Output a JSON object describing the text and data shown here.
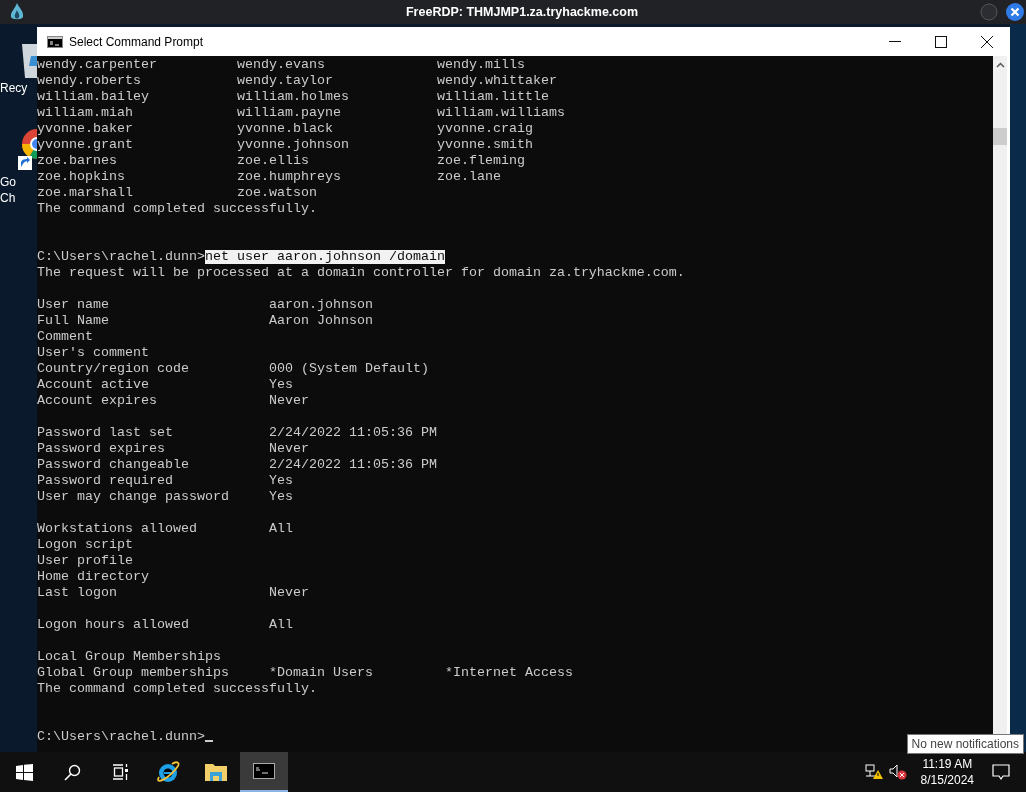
{
  "rdp_window": {
    "title": "FreeRDP: THMJMP1.za.tryhackme.com"
  },
  "desktop_icons": [
    {
      "label_lines": [
        "Recy"
      ],
      "kind": "recycle"
    },
    {
      "label_lines": [
        "Go",
        "Ch"
      ],
      "kind": "browser"
    }
  ],
  "console_window": {
    "title": "Select Command Prompt",
    "lines": [
      {
        "kind": "text",
        "text": "wendy.carpenter          wendy.evans              wendy.mills"
      },
      {
        "kind": "text",
        "text": "wendy.roberts            wendy.taylor             wendy.whittaker"
      },
      {
        "kind": "text",
        "text": "william.bailey           william.holmes           william.little"
      },
      {
        "kind": "text",
        "text": "william.miah             william.payne            william.williams"
      },
      {
        "kind": "text",
        "text": "yvonne.baker             yvonne.black             yvonne.craig"
      },
      {
        "kind": "text",
        "text": "yvonne.grant             yvonne.johnson           yvonne.smith"
      },
      {
        "kind": "text",
        "text": "zoe.barnes               zoe.ellis                zoe.fleming"
      },
      {
        "kind": "text",
        "text": "zoe.hopkins              zoe.humphreys            zoe.lane"
      },
      {
        "kind": "text",
        "text": "zoe.marshall             zoe.watson"
      },
      {
        "kind": "text",
        "text": "The command completed successfully."
      },
      {
        "kind": "blank"
      },
      {
        "kind": "blank"
      },
      {
        "kind": "prompt",
        "prompt": "C:\\Users\\rachel.dunn>",
        "command": "net user aaron.johnson /domain",
        "selected": true
      },
      {
        "kind": "text",
        "text": "The request will be processed at a domain controller for domain za.tryhackme.com."
      },
      {
        "kind": "blank"
      },
      {
        "kind": "text",
        "text": "User name                    aaron.johnson"
      },
      {
        "kind": "text",
        "text": "Full Name                    Aaron Johnson"
      },
      {
        "kind": "text",
        "text": "Comment"
      },
      {
        "kind": "text",
        "text": "User's comment"
      },
      {
        "kind": "text",
        "text": "Country/region code          000 (System Default)"
      },
      {
        "kind": "text",
        "text": "Account active               Yes"
      },
      {
        "kind": "text",
        "text": "Account expires              Never"
      },
      {
        "kind": "blank"
      },
      {
        "kind": "text",
        "text": "Password last set            2/24/2022 11:05:36 PM"
      },
      {
        "kind": "text",
        "text": "Password expires             Never"
      },
      {
        "kind": "text",
        "text": "Password changeable          2/24/2022 11:05:36 PM"
      },
      {
        "kind": "text",
        "text": "Password required            Yes"
      },
      {
        "kind": "text",
        "text": "User may change password     Yes"
      },
      {
        "kind": "blank"
      },
      {
        "kind": "text",
        "text": "Workstations allowed         All"
      },
      {
        "kind": "text",
        "text": "Logon script"
      },
      {
        "kind": "text",
        "text": "User profile"
      },
      {
        "kind": "text",
        "text": "Home directory"
      },
      {
        "kind": "text",
        "text": "Last logon                   Never"
      },
      {
        "kind": "blank"
      },
      {
        "kind": "text",
        "text": "Logon hours allowed          All"
      },
      {
        "kind": "blank"
      },
      {
        "kind": "text",
        "text": "Local Group Memberships"
      },
      {
        "kind": "text",
        "text": "Global Group memberships     *Domain Users         *Internet Access"
      },
      {
        "kind": "text",
        "text": "The command completed successfully."
      },
      {
        "kind": "blank"
      },
      {
        "kind": "blank"
      },
      {
        "kind": "prompt",
        "prompt": "C:\\Users\\rachel.dunn>",
        "cursor": true
      }
    ]
  },
  "taskbar": {
    "apps": [
      {
        "kind": "start",
        "active": false
      },
      {
        "kind": "search",
        "active": false
      },
      {
        "kind": "taskview",
        "active": false
      },
      {
        "kind": "ie",
        "active": false
      },
      {
        "kind": "folder",
        "active": false
      },
      {
        "kind": "cmd",
        "active": true
      }
    ],
    "clock": {
      "time": "11:19 AM",
      "date": "8/15/2024"
    }
  },
  "tooltip": {
    "text": "No new notifications"
  }
}
